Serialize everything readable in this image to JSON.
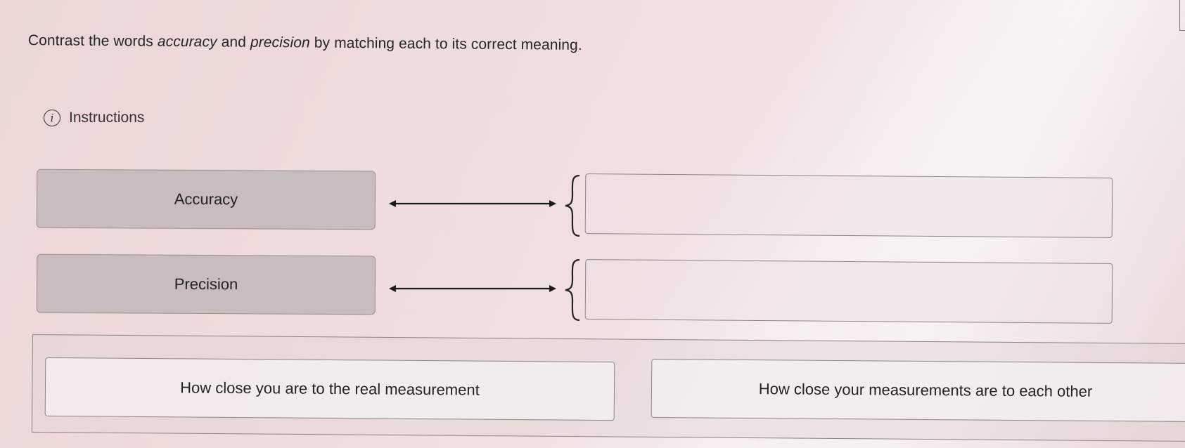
{
  "question": {
    "prefix": "Contrast the words ",
    "term1": "accuracy",
    "middle": " and ",
    "term2": "precision",
    "suffix": " by matching each to its correct meaning."
  },
  "instructions": {
    "icon": "info-icon",
    "icon_glyph": "i",
    "label": "Instructions"
  },
  "terms": [
    {
      "label": "Accuracy"
    },
    {
      "label": "Precision"
    }
  ],
  "answer_bank": [
    {
      "label": "How close you are to the real measurement"
    },
    {
      "label": "How close your measurements are to each other"
    }
  ],
  "colors": {
    "term_bg": "#c9bcbc",
    "border": "#8d8585",
    "arrow": "#1a1a1a"
  }
}
